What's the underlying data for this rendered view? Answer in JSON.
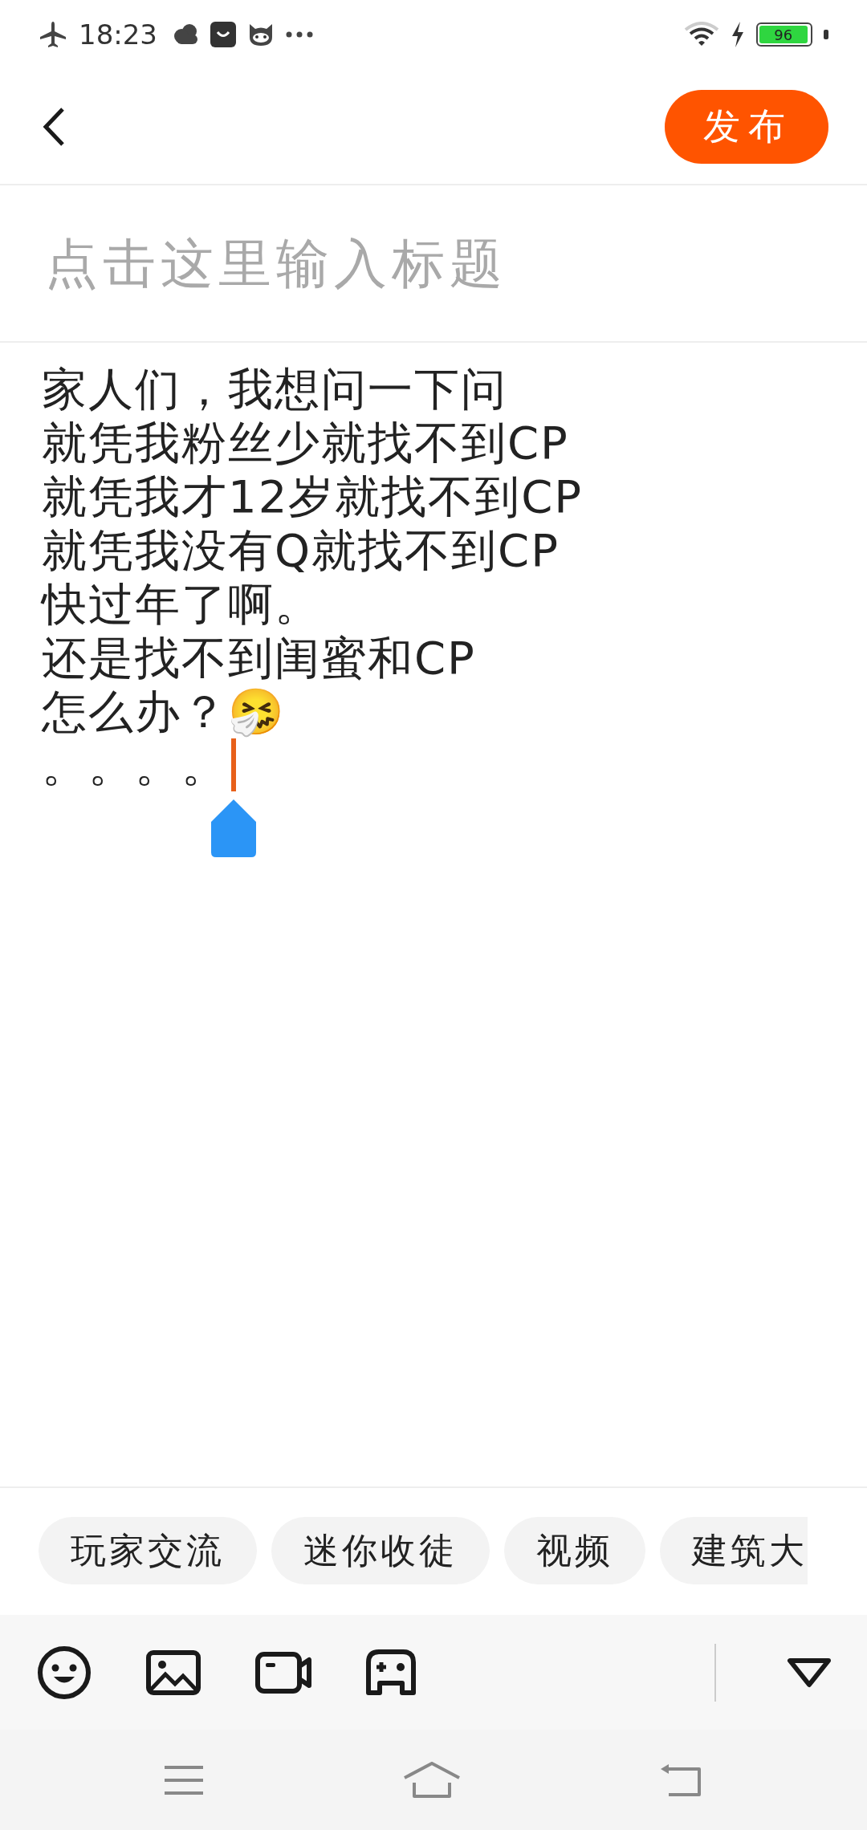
{
  "status_bar": {
    "time": "18:23",
    "battery": "96"
  },
  "header": {
    "publish_button": "发布"
  },
  "title_field": {
    "placeholder": "点击这里输入标题"
  },
  "body": {
    "lines": [
      "家人们，我想问一下问",
      "就凭我粉丝少就找不到CP",
      "就凭我才12岁就找不到CP",
      "就凭我没有Q就找不到CP",
      "快过年了啊。",
      "还是找不到闺蜜和CP",
      "怎么办？🤧",
      "。。。。"
    ]
  },
  "topics": [
    "玩家交流",
    "迷你收徒",
    "视频",
    "建筑大"
  ],
  "toolbar": {
    "tools": [
      {
        "kind": "emoji"
      },
      {
        "kind": "image"
      },
      {
        "kind": "video"
      },
      {
        "kind": "game"
      }
    ]
  }
}
